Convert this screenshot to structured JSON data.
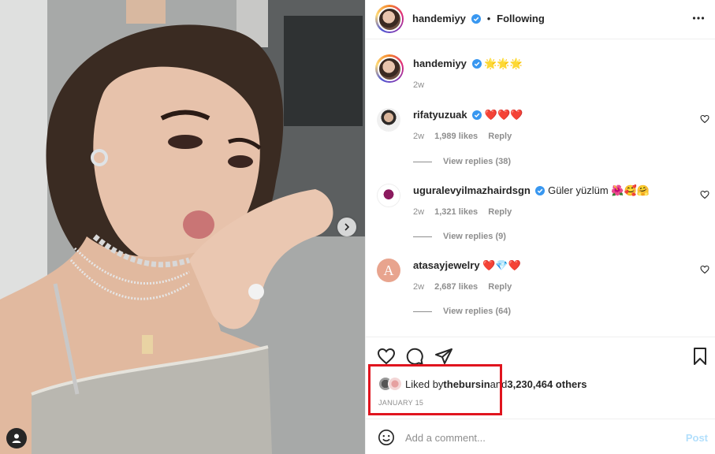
{
  "photo": {
    "icons": {
      "next": "chevron-right-icon",
      "tags": "user-tag-icon"
    }
  },
  "header": {
    "username": "handemiyy",
    "separator": "•",
    "follow_status": "Following",
    "icons": {
      "verified": "verified-badge-icon",
      "more": "more-options-icon"
    }
  },
  "caption": {
    "username": "handemiyy",
    "text": "🌟🌟🌟",
    "time": "2w"
  },
  "comments": [
    {
      "username": "rifatyuzuak",
      "text": "❤️❤️❤️",
      "time": "2w",
      "likes": "1,989 likes",
      "reply": "Reply",
      "view_replies": "View replies (38)"
    },
    {
      "username": "uguralevyilmazhairdsgn",
      "text": "Güler yüzlüm 🌺🥰🤗",
      "time": "2w",
      "likes": "1,321 likes",
      "reply": "Reply",
      "view_replies": "View replies (9)"
    },
    {
      "username": "atasayjewelry",
      "avatar_letter": "A",
      "text": "❤️💎❤️",
      "time": "2w",
      "likes": "2,687 likes",
      "reply": "Reply",
      "view_replies": "View replies (64)"
    }
  ],
  "actions": {
    "icons": {
      "like": "heart-icon",
      "comment": "comment-icon",
      "share": "share-icon",
      "save": "bookmark-icon"
    }
  },
  "likes": {
    "prefix": "Liked by ",
    "user": "thebursin",
    "middle": " and ",
    "count": "3,230,464 others"
  },
  "date": "JANUARY 15",
  "add_comment": {
    "placeholder": "Add a comment...",
    "post_label": "Post",
    "icons": {
      "emoji": "emoji-icon"
    }
  },
  "colors": {
    "verified": "#3897f0",
    "link": "#0095f6",
    "post_disabled": "#b2dffc",
    "highlight": "#e0141e"
  }
}
